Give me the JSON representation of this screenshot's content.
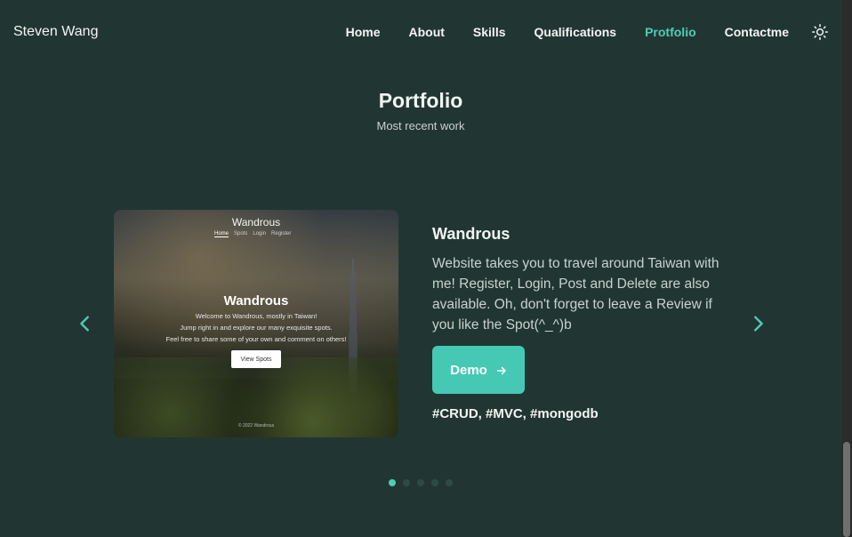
{
  "brand": "Steven Wang",
  "nav": {
    "items": [
      {
        "label": "Home"
      },
      {
        "label": "About"
      },
      {
        "label": "Skills"
      },
      {
        "label": "Qualifications"
      },
      {
        "label": "Protfolio"
      },
      {
        "label": "Contactme"
      }
    ],
    "active_index": 4,
    "theme_icon": "sun-icon"
  },
  "section": {
    "title": "Portfolio",
    "subtitle": "Most recent work"
  },
  "carousel": {
    "prev_icon": "chevron-left-icon",
    "next_icon": "chevron-right-icon",
    "project": {
      "title": "Wandrous",
      "description": "Website takes you to travel around Taiwan with me! Register, Login, Post and Delete are also available. Oh, don't forget to leave a Review if you like the Spot(^_^)b",
      "demo_label": "Demo",
      "tags": "#CRUD, #MVC, #mongodb",
      "screenshot": {
        "brand": "Wandrous",
        "nav": [
          "Home",
          "Spots",
          "Login",
          "Register"
        ],
        "hero_title": "Wandrous",
        "hero_lines": [
          "Welcome to Wandrous, mostly in Taiwan!",
          "Jump right in and explore our many exquisite spots.",
          "Feel free to share some of your own and comment on others!"
        ],
        "button": "View Spots",
        "footer": "© 2022 Wandrous"
      }
    },
    "dots": 5,
    "active_dot": 0
  },
  "colors": {
    "background": "#213632",
    "accent": "#4ecdb4",
    "button": "#45c9b4"
  }
}
